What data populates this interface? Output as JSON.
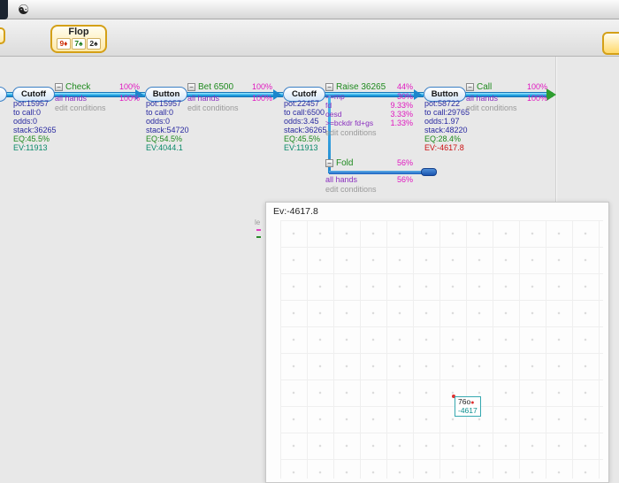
{
  "window": {
    "yin_yang_icon": "☯"
  },
  "toolbar": {
    "street_label": "Flop",
    "cards": [
      {
        "text": "9♦",
        "color": "#cc2a00"
      },
      {
        "text": "7♠",
        "color": "#1b7a1b"
      },
      {
        "text": "2♠",
        "color": "#222222"
      }
    ]
  },
  "ui": {
    "minus": "−",
    "arrow_color": "#2fb0ea"
  },
  "tree": {
    "nodes": [
      {
        "label": "Cutoff",
        "pot": "pot:15957",
        "to_call": "to call:0",
        "odds": "odds:0",
        "stack": "stack:36265",
        "eq": "EQ:45.5%",
        "ev": "EV:11913",
        "ev_color": "#0a8a6a"
      },
      {
        "label": "Button",
        "pot": "pot:15957",
        "to_call": "to call:0",
        "odds": "odds:0",
        "stack": "stack:54720",
        "eq": "EQ:54.5%",
        "ev": "EV:4044.1",
        "ev_color": "#0a8a6a"
      },
      {
        "label": "Cutoff",
        "pot": "pot:22457",
        "to_call": "to call:6500",
        "odds": "odds:3.45",
        "stack": "stack:36265",
        "eq": "EQ:45.5%",
        "ev": "EV:11913",
        "ev_color": "#0a8a6a"
      },
      {
        "label": "Button",
        "pot": "pot:58722",
        "to_call": "to call:29765",
        "odds": "odds:1.97",
        "stack": "stack:48220",
        "eq": "EQ:28.4%",
        "ev": "EV:-4617.8",
        "ev_color": "#cc1111"
      }
    ],
    "actions": [
      {
        "name": "Check",
        "pct": "100%",
        "range": "all hands",
        "range_pct": "100%",
        "edit": "edit conditions"
      },
      {
        "name": "Bet 6500",
        "pct": "100%",
        "range": "all hands",
        "range_pct": "100%",
        "edit": "edit conditions"
      },
      {
        "name": "Raise 36265",
        "pct": "44%",
        "edit": "edit conditions",
        "conditions": [
          {
            "label": ">=mp",
            "pct": "30%"
          },
          {
            "label": "fd",
            "pct": "9.33%"
          },
          {
            "label": "oesd",
            "pct": "3.33%"
          },
          {
            "label": ">=bckdr fd+gs",
            "pct": "1.33%"
          }
        ]
      },
      {
        "name": "Call",
        "pct": "100%",
        "range": "all hands",
        "range_pct": "100%",
        "edit": "edit conditions"
      }
    ],
    "fold": {
      "name": "Fold",
      "pct": "56%",
      "range": "all hands",
      "range_pct": "56%",
      "edit": "edit conditions"
    }
  },
  "chart": {
    "title": "Ev:-4617.8",
    "point": {
      "x": "76o",
      "y": "-4617"
    }
  },
  "chart_data": {
    "type": "scatter",
    "title": "Ev:-4617.8",
    "points": [
      {
        "hand": "76o",
        "ev": -4617
      }
    ],
    "grid": "on",
    "notes": "EV graph panel; one highlighted point labeled with hand 76o and EV -4617"
  },
  "fragments": {
    "text": "le"
  }
}
